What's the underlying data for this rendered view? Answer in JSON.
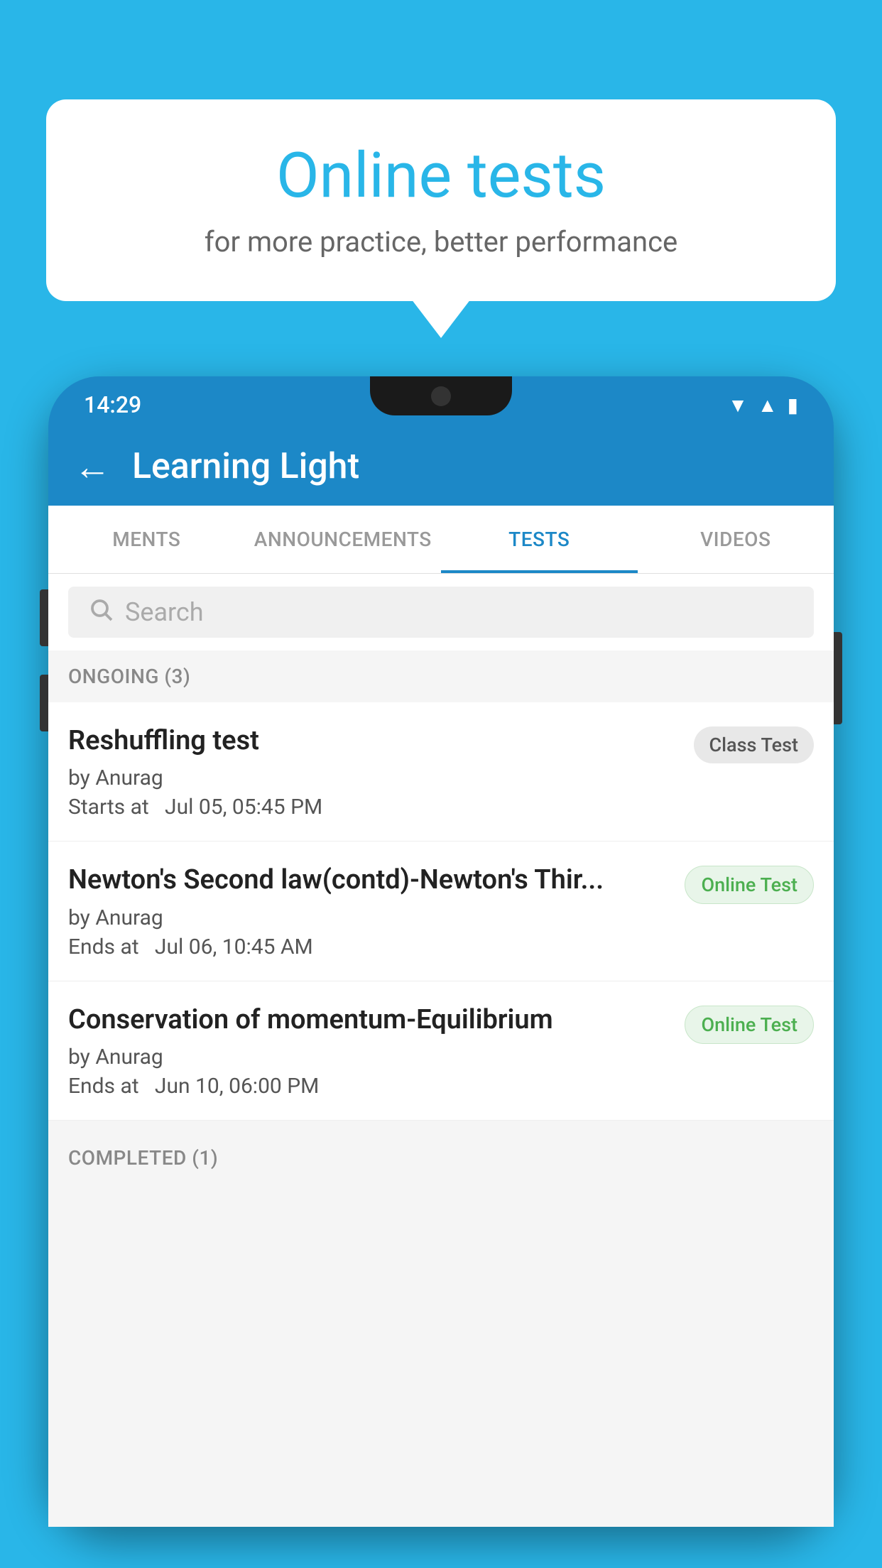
{
  "background_color": "#29B6E8",
  "bubble": {
    "title": "Online tests",
    "subtitle": "for more practice, better performance"
  },
  "phone": {
    "status_bar": {
      "time": "14:29",
      "icons": [
        "wifi",
        "signal",
        "battery"
      ]
    },
    "app_bar": {
      "back_label": "←",
      "title": "Learning Light"
    },
    "tabs": [
      {
        "label": "MENTS",
        "active": false
      },
      {
        "label": "ANNOUNCEMENTS",
        "active": false
      },
      {
        "label": "TESTS",
        "active": true
      },
      {
        "label": "VIDEOS",
        "active": false
      }
    ],
    "search": {
      "placeholder": "Search"
    },
    "ongoing_section": {
      "title": "ONGOING (3)",
      "tests": [
        {
          "name": "Reshuffling test",
          "author": "by Anurag",
          "time_label": "Starts at",
          "time": "Jul 05, 05:45 PM",
          "badge": "Class Test",
          "badge_type": "class"
        },
        {
          "name": "Newton's Second law(contd)-Newton's Thir...",
          "author": "by Anurag",
          "time_label": "Ends at",
          "time": "Jul 06, 10:45 AM",
          "badge": "Online Test",
          "badge_type": "online"
        },
        {
          "name": "Conservation of momentum-Equilibrium",
          "author": "by Anurag",
          "time_label": "Ends at",
          "time": "Jun 10, 06:00 PM",
          "badge": "Online Test",
          "badge_type": "online"
        }
      ]
    },
    "completed_section": {
      "title": "COMPLETED (1)"
    }
  }
}
